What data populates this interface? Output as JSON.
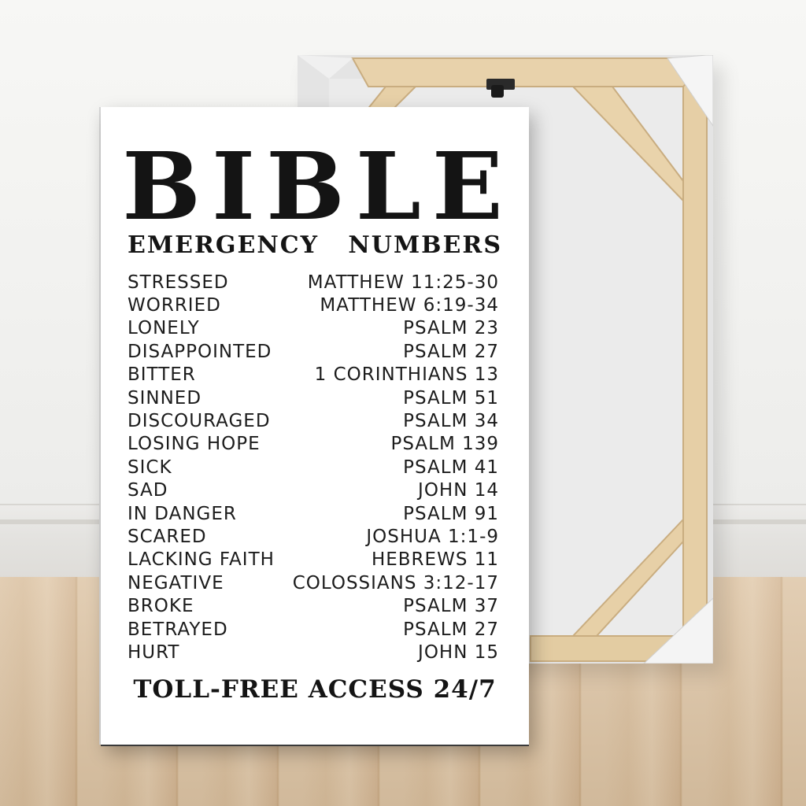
{
  "poster": {
    "title": "BIBLE",
    "subtitle_left": "EMERGENCY",
    "subtitle_right": "NUMBERS",
    "rows": [
      {
        "feeling": "STRESSED",
        "verse": "MATTHEW 11:25-30"
      },
      {
        "feeling": "WORRIED",
        "verse": "MATTHEW 6:19-34"
      },
      {
        "feeling": "LONELY",
        "verse": "PSALM 23"
      },
      {
        "feeling": "DISAPPOINTED",
        "verse": "PSALM 27"
      },
      {
        "feeling": "BITTER",
        "verse": "1 CORINTHIANS 13"
      },
      {
        "feeling": "SINNED",
        "verse": "PSALM 51"
      },
      {
        "feeling": "DISCOURAGED",
        "verse": "PSALM 34"
      },
      {
        "feeling": "LOSING HOPE",
        "verse": "PSALM 139"
      },
      {
        "feeling": "SICK",
        "verse": "PSALM 41"
      },
      {
        "feeling": "SAD",
        "verse": "JOHN 14"
      },
      {
        "feeling": "IN DANGER",
        "verse": "PSALM 91"
      },
      {
        "feeling": "SCARED",
        "verse": "JOSHUA 1:1-9"
      },
      {
        "feeling": "LACKING FAITH",
        "verse": "HEBREWS 11"
      },
      {
        "feeling": "NEGATIVE",
        "verse": "COLOSSIANS 3:12-17"
      },
      {
        "feeling": "BROKE",
        "verse": "PSALM 37"
      },
      {
        "feeling": "BETRAYED",
        "verse": "PSALM 27"
      },
      {
        "feeling": "HURT",
        "verse": "JOHN 15"
      }
    ],
    "footer": "TOLL-FREE ACCESS 24/7"
  },
  "colors": {
    "wall": "#f3f3f1",
    "floor": "#d8bd9b",
    "frame_wood": "#e6cfa6",
    "poster_bg": "#ffffff",
    "ink": "#141414"
  }
}
